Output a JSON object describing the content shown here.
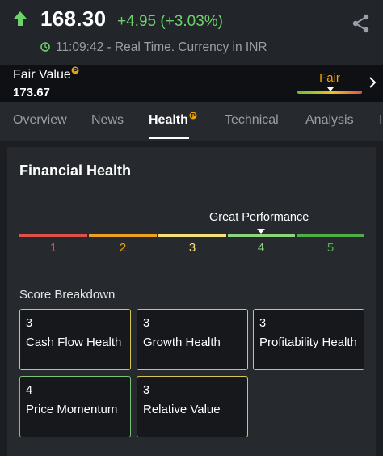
{
  "quote": {
    "price": "168.30",
    "change": "+4.95 (+3.03%)",
    "realtime": "11:09:42 - Real Time. Currency in INR",
    "colors": {
      "up": "#6cd36c",
      "muted": "#9a9ea6"
    },
    "icons": [
      "arrow-up-icon",
      "share-icon",
      "clock-icon"
    ]
  },
  "fair_value": {
    "label": "Fair Value",
    "value": "173.67",
    "status": "Fair",
    "status_color": "#f0a20a",
    "icons": [
      "pro-badge-icon",
      "chevron-right-icon"
    ]
  },
  "tabs": [
    {
      "label": "Overview",
      "active": false
    },
    {
      "label": "News",
      "active": false
    },
    {
      "label": "Health",
      "active": true
    },
    {
      "label": "Technical",
      "active": false
    },
    {
      "label": "Analysis",
      "active": false
    },
    {
      "label": "I",
      "active": false
    }
  ],
  "health": {
    "title": "Financial Health",
    "performance_label": "Great Performance",
    "score": 4,
    "scale": [
      {
        "n": "1",
        "color": "#e0504a"
      },
      {
        "n": "2",
        "color": "#f0a020"
      },
      {
        "n": "3",
        "color": "#f6e07a"
      },
      {
        "n": "4",
        "color": "#8ed47c"
      },
      {
        "n": "5",
        "color": "#4fae46"
      }
    ],
    "breakdown_title": "Score Breakdown",
    "breakdown": [
      {
        "score": "3",
        "label": "Cash Flow Health"
      },
      {
        "score": "3",
        "label": "Growth Health"
      },
      {
        "score": "3",
        "label": "Profitability Health"
      },
      {
        "score": "4",
        "label": "Price Momentum"
      },
      {
        "score": "3",
        "label": "Relative Value"
      }
    ]
  }
}
